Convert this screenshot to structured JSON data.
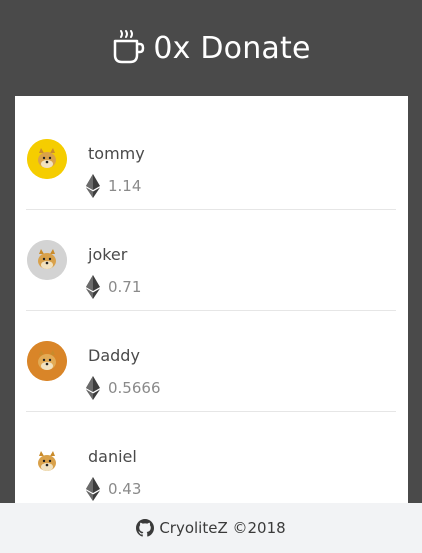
{
  "header": {
    "icon": "coffee-cup-icon",
    "title": "0x Donate"
  },
  "donations": [
    {
      "name": "tommy",
      "amount": "1.14",
      "avatar_bg": "#f5cd00"
    },
    {
      "name": "joker",
      "amount": "0.71",
      "avatar_bg": "#d3d3d3"
    },
    {
      "name": "Daddy",
      "amount": "0.5666",
      "avatar_bg": "#d98528"
    },
    {
      "name": "daniel",
      "amount": "0.43",
      "avatar_bg": "#ffffff"
    }
  ],
  "footer": {
    "icon": "github-icon",
    "text": "CryoliteZ ©2018"
  }
}
